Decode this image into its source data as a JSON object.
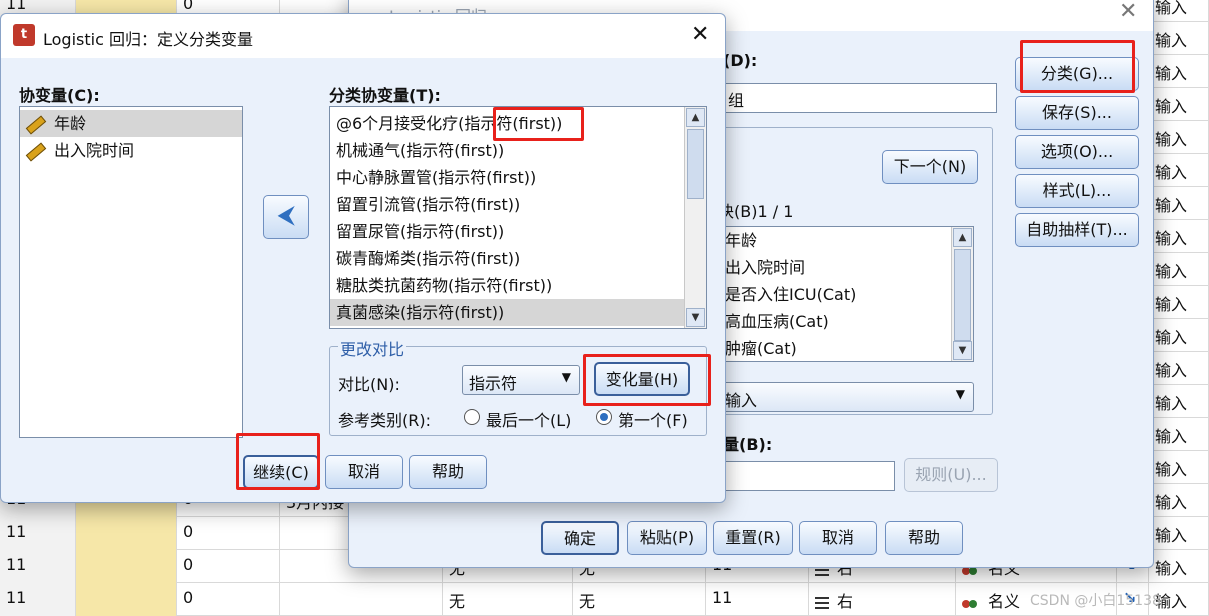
{
  "spreadsheet": {
    "rows": [
      {
        "c0": "11",
        "c2": "0",
        "c3": "",
        "c4": "",
        "c5": "",
        "c6": "",
        "c7": "",
        "c8": "",
        "c10": "输入"
      },
      {
        "c0": "",
        "c2": "",
        "c3": "",
        "c4": "",
        "c5": "",
        "c6": "",
        "c7": "",
        "c8": "",
        "c10": "输入"
      },
      {
        "c0": "",
        "c2": "",
        "c3": "",
        "c4": "",
        "c5": "",
        "c6": "",
        "c7": "",
        "c8": "",
        "c10": "输入"
      },
      {
        "c0": "",
        "c2": "",
        "c3": "",
        "c4": "",
        "c5": "",
        "c6": "",
        "c7": "",
        "c8": "",
        "c10": "输入"
      },
      {
        "c0": "",
        "c2": "",
        "c3": "",
        "c4": "",
        "c5": "",
        "c6": "",
        "c7": "",
        "c8": "",
        "c10": "输入"
      },
      {
        "c0": "",
        "c2": "",
        "c3": "",
        "c4": "",
        "c5": "",
        "c6": "",
        "c7": "",
        "c8": "",
        "c10": "输入"
      },
      {
        "c0": "",
        "c2": "",
        "c3": "",
        "c4": "",
        "c5": "",
        "c6": "",
        "c7": "",
        "c8": "",
        "c10": "输入"
      },
      {
        "c0": "",
        "c2": "",
        "c3": "",
        "c4": "",
        "c5": "",
        "c6": "",
        "c7": "",
        "c8": "",
        "c10": "输入"
      },
      {
        "c0": "",
        "c2": "",
        "c3": "",
        "c4": "",
        "c5": "",
        "c6": "",
        "c7": "",
        "c8": "",
        "c10": "输入"
      },
      {
        "c0": "",
        "c2": "",
        "c3": "",
        "c4": "",
        "c5": "",
        "c6": "",
        "c7": "",
        "c8": "",
        "c10": "输入"
      },
      {
        "c0": "",
        "c2": "",
        "c3": "",
        "c4": "",
        "c5": "",
        "c6": "",
        "c7": "",
        "c8": "",
        "c10": "输入"
      },
      {
        "c0": "",
        "c2": "",
        "c3": "",
        "c4": "",
        "c5": "",
        "c6": "",
        "c7": "",
        "c8": "",
        "c10": "输入"
      },
      {
        "c0": "",
        "c2": "",
        "c3": "",
        "c4": "",
        "c5": "",
        "c6": "",
        "c7": "",
        "c8": "",
        "c10": "输入"
      },
      {
        "c0": "",
        "c2": "",
        "c3": "",
        "c4": "",
        "c5": "",
        "c6": "",
        "c7": "",
        "c8": "",
        "c10": "输入"
      },
      {
        "c0": "",
        "c2": "",
        "c3": "",
        "c4": "",
        "c5": "",
        "c6": "",
        "c7": "",
        "c8": "",
        "c10": "输入"
      },
      {
        "c0": "11",
        "c2": "0",
        "c3": "3月内接",
        "c4": "",
        "c5": "",
        "c6": "",
        "c7": "",
        "c8": "",
        "c10": "输入"
      },
      {
        "c0": "11",
        "c2": "0",
        "c3": "",
        "c4": "",
        "c5": "",
        "c6": "",
        "c7": "",
        "c8": "",
        "c10": "输入"
      },
      {
        "c0": "11",
        "c2": "0",
        "c3": "",
        "c4": "无",
        "c5": "无",
        "c6": "11",
        "c7": "右",
        "c8": "名义",
        "c10": "输入"
      },
      {
        "c0": "11",
        "c2": "0",
        "c3": "",
        "c4": "无",
        "c5": "无",
        "c6": "11",
        "c7": "右",
        "c8": "名义",
        "c10": "输入"
      }
    ]
  },
  "main_dialog": {
    "title": "Logistic 回归",
    "dep_label": "(D):",
    "dep_value": "组",
    "next_button": "下一个(N)",
    "block_label": "块(B)1 / 1",
    "covariates": [
      "年龄",
      "出入院时间",
      "是否入住ICU(Cat)",
      "高血压病(Cat)",
      "肿瘤(Cat)"
    ],
    "method_value": "输入",
    "selection_label": "量(B):",
    "rule_button": "规则(U)...",
    "side_buttons": [
      "分类(G)...",
      "保存(S)...",
      "选项(O)...",
      "样式(L)...",
      "自助抽样(T)..."
    ],
    "bottom_buttons": [
      "确定",
      "粘贴(P)",
      "重置(R)",
      "取消",
      "帮助"
    ]
  },
  "front_dialog": {
    "title": "Logistic 回归：定义分类变量",
    "covariates_label": "协变量(C):",
    "covariates": [
      "年龄",
      "出入院时间"
    ],
    "categorical_label": "分类协变量(T):",
    "categorical": [
      "@6个月接受化疗(指示符(first))",
      "机械通气(指示符(first))",
      "中心静脉置管(指示符(first))",
      "留置引流管(指示符(first))",
      "留置尿管(指示符(first))",
      "碳青酶烯类(指示符(first))",
      "糖肽类抗菌药物(指示符(first))",
      "真菌感染(指示符(first))"
    ],
    "change_contrast_legend": "更改对比",
    "contrast_label": "对比(N):",
    "contrast_value": "指示符",
    "change_button": "变化量(H)",
    "reference_label": "参考类别(R):",
    "ref_last": "最后一个(L)",
    "ref_first": "第一个(F)",
    "continue_button": "继续(C)",
    "cancel_button": "取消",
    "help_button": "帮助"
  },
  "watermark": "CSDN @小白15138",
  "colors": {
    "highlight_red": "#e8211b",
    "dialog_bg": "#eaf1fb",
    "selected_column": "#f6e7a8"
  }
}
